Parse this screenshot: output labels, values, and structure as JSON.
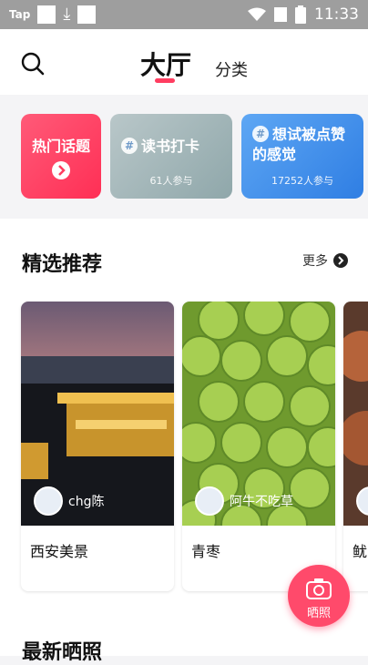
{
  "status_bar": {
    "app": "Tap",
    "time": "11:33"
  },
  "header": {
    "tabs": [
      {
        "label": "大厅",
        "active": true
      },
      {
        "label": "分类",
        "active": false
      }
    ]
  },
  "topics": [
    {
      "title": "热门话题",
      "subtitle": ""
    },
    {
      "title": "读书打卡",
      "subtitle": "61人参与"
    },
    {
      "title": "想试被点赞的感觉",
      "subtitle": "17252人参与"
    }
  ],
  "featured": {
    "title": "精选推荐",
    "more_label": "更多"
  },
  "posts": [
    {
      "title": "西安美景",
      "author": "chg陈"
    },
    {
      "title": "青枣",
      "author": "阿牛不吃草"
    },
    {
      "title": "鱿"
    }
  ],
  "latest": {
    "title": "最新晒照"
  },
  "fab": {
    "label": "晒照"
  },
  "colors": {
    "accent": "#ff3d60",
    "topic_hot": "#ff3d60",
    "topic_like": "#3f8ee9",
    "status_bar": "#9e9e9e"
  }
}
